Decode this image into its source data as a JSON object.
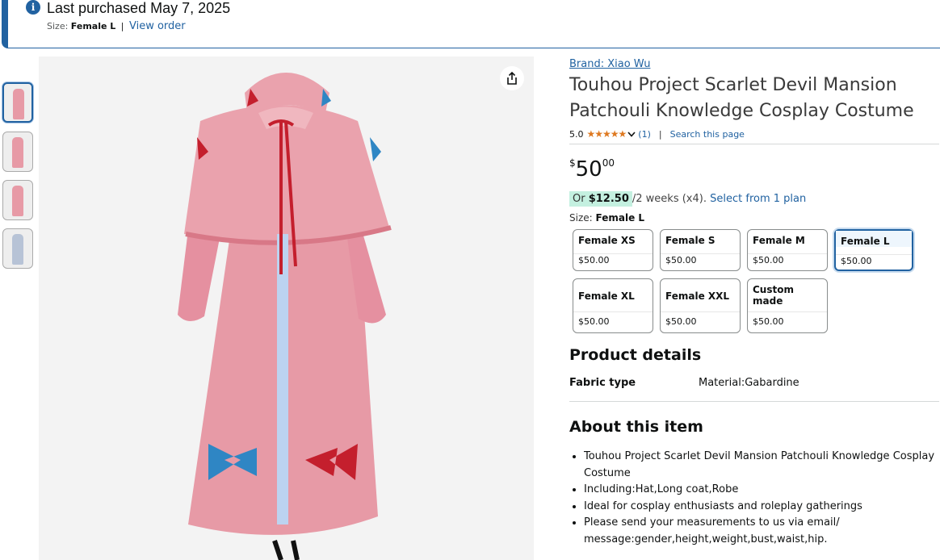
{
  "banner": {
    "purchased_text": "Last purchased May 7, 2025",
    "size_label": "Size:",
    "size_value": "Female L",
    "separator": "|",
    "view_order": "View order",
    "info_icon": "info-icon"
  },
  "gallery": {
    "thumbnails": [
      "thumbnail-1",
      "thumbnail-2",
      "thumbnail-3",
      "thumbnail-4"
    ],
    "selected_index": 0,
    "share_icon": "share-icon"
  },
  "product": {
    "brand": "Brand: Xiao Wu",
    "title": "Touhou Project Scarlet Devil Mansion Patchouli Knowledge Cosplay Costume",
    "rating_value": "5.0",
    "stars": "★★★★★",
    "rating_count": "(1)",
    "pipe": "|",
    "search_page": "Search this page",
    "price_symbol": "$",
    "price_whole": "50",
    "price_fraction": "00",
    "plan_or": "Or",
    "plan_amount": "$12.50",
    "plan_terms": "/2 weeks (x4).",
    "plan_link": "Select from 1 plan",
    "size_label": "Size:",
    "size_selected": "Female L"
  },
  "size_options": [
    {
      "name": "Female XS",
      "price": "$50.00"
    },
    {
      "name": "Female S",
      "price": "$50.00"
    },
    {
      "name": "Female M",
      "price": "$50.00"
    },
    {
      "name": "Female L",
      "price": "$50.00"
    },
    {
      "name": "Female XL",
      "price": "$50.00"
    },
    {
      "name": "Female XXL",
      "price": "$50.00"
    },
    {
      "name": "Custom made",
      "price": "$50.00"
    }
  ],
  "details": {
    "heading": "Product details",
    "fabric_label": "Fabric type",
    "fabric_value": "Material:Gabardine"
  },
  "about": {
    "heading": "About this item",
    "bullets": [
      "Touhou Project Scarlet Devil Mansion Patchouli Knowledge Cosplay Costume",
      "Including:Hat,Long coat,Robe",
      "Ideal for cosplay enthusiasts and roleplay gatherings",
      "Please send your measurements to us via email/ message:gender,height,weight,bust,waist,hip."
    ]
  },
  "colors": {
    "link": "#2162a1",
    "star": "#de7921",
    "plan_highlight": "#c4f0e0",
    "costume_pink": "#e79aa6"
  }
}
